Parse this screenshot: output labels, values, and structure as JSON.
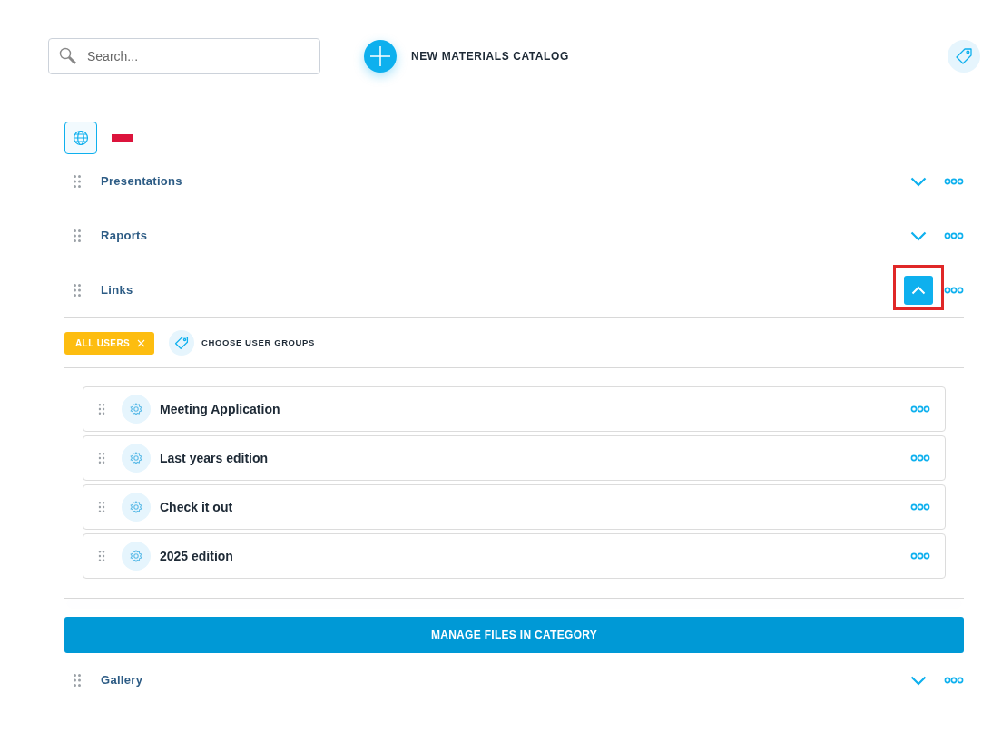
{
  "search": {
    "placeholder": "Search..."
  },
  "new_catalog_button": {
    "label": "NEW MATERIALS CATALOG"
  },
  "categories": [
    {
      "name": "Presentations",
      "expanded": false,
      "highlighted": false
    },
    {
      "name": "Raports",
      "expanded": false,
      "highlighted": false
    },
    {
      "name": "Links",
      "expanded": true,
      "highlighted": true,
      "user_groups": [
        {
          "label": "ALL USERS"
        }
      ],
      "choose_groups_label": "CHOOSE USER GROUPS",
      "items": [
        {
          "title": "Meeting Application"
        },
        {
          "title": "Last years edition"
        },
        {
          "title": "Check it out"
        },
        {
          "title": "2025 edition"
        }
      ],
      "manage_button": "MANAGE FILES IN CATEGORY"
    },
    {
      "name": "Gallery",
      "expanded": false,
      "highlighted": false
    }
  ]
}
